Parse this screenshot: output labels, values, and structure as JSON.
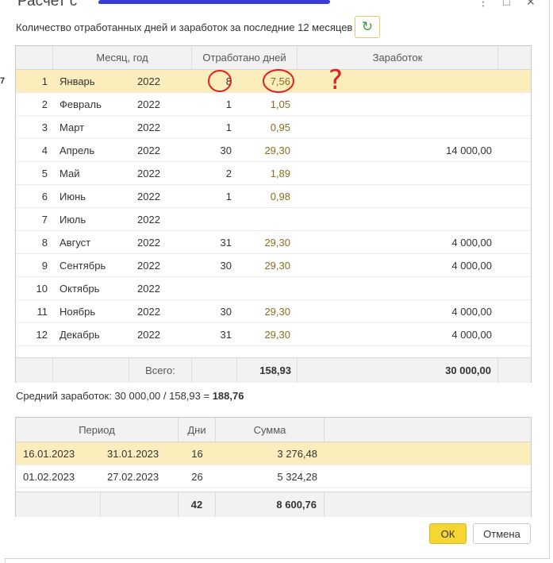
{
  "window": {
    "title": "Расчет с",
    "controls": [
      "⋮",
      "□",
      "✕"
    ]
  },
  "description": "Количество отработанных дней и заработок за последние 12 месяцев",
  "refresh_icon": "refresh-icon",
  "months_table": {
    "headers": {
      "month": "Месяц, год",
      "days": "Отработано дней",
      "earnings": "Заработок"
    },
    "rows": [
      {
        "n": "1",
        "month": "Январь",
        "year": "2022",
        "worked": "8",
        "days": "7,56",
        "earn": ""
      },
      {
        "n": "2",
        "month": "Февраль",
        "year": "2022",
        "worked": "1",
        "days": "1,05",
        "earn": ""
      },
      {
        "n": "3",
        "month": "Март",
        "year": "2022",
        "worked": "1",
        "days": "0,95",
        "earn": ""
      },
      {
        "n": "4",
        "month": "Апрель",
        "year": "2022",
        "worked": "30",
        "days": "29,30",
        "earn": "14 000,00"
      },
      {
        "n": "5",
        "month": "Май",
        "year": "2022",
        "worked": "2",
        "days": "1,89",
        "earn": ""
      },
      {
        "n": "6",
        "month": "Июнь",
        "year": "2022",
        "worked": "1",
        "days": "0,98",
        "earn": ""
      },
      {
        "n": "7",
        "month": "Июль",
        "year": "2022",
        "worked": "",
        "days": "",
        "earn": ""
      },
      {
        "n": "8",
        "month": "Август",
        "year": "2022",
        "worked": "31",
        "days": "29,30",
        "earn": "4 000,00"
      },
      {
        "n": "9",
        "month": "Сентябрь",
        "year": "2022",
        "worked": "30",
        "days": "29,30",
        "earn": "4 000,00"
      },
      {
        "n": "10",
        "month": "Октябрь",
        "year": "2022",
        "worked": "",
        "days": "",
        "earn": ""
      },
      {
        "n": "11",
        "month": "Ноябрь",
        "year": "2022",
        "worked": "30",
        "days": "29,30",
        "earn": "4 000,00"
      },
      {
        "n": "12",
        "month": "Декабрь",
        "year": "2022",
        "worked": "31",
        "days": "29,30",
        "earn": "4 000,00"
      }
    ],
    "footer": {
      "label": "Всего:",
      "days_total": "158,93",
      "earn_total": "30 000,00"
    }
  },
  "average": {
    "text": "Средний заработок: 30 000,00 / 158,93 = ",
    "value": "188,76"
  },
  "periods_table": {
    "headers": {
      "period": "Период",
      "days": "Дни",
      "sum": "Сумма"
    },
    "rows": [
      {
        "from": "16.01.2023",
        "to": "31.01.2023",
        "days": "16",
        "sum": "3 276,48"
      },
      {
        "from": "01.02.2023",
        "to": "27.02.2023",
        "days": "26",
        "sum": "5 324,28"
      }
    ],
    "footer": {
      "days_total": "42",
      "sum_total": "8 600,76"
    }
  },
  "buttons": {
    "ok": "ОК",
    "cancel": "Отмена"
  },
  "annotation": {
    "mark": "?",
    "color": "#e02020"
  },
  "colors": {
    "selected_row": "#fbeebc",
    "accent": "#f5d633",
    "link_value": "#8a6d1e"
  }
}
